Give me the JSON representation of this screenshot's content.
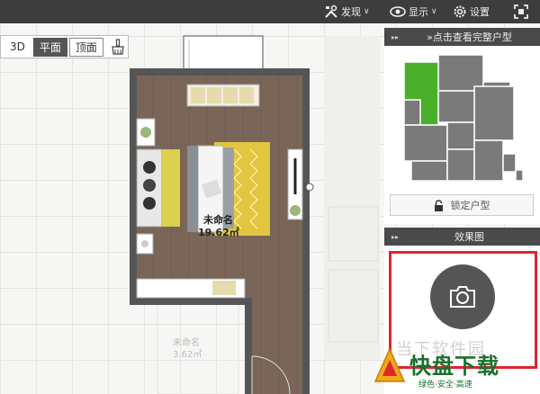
{
  "toolbar": {
    "discover_label": "发现",
    "display_label": "显示",
    "settings_label": "设置"
  },
  "view_toggle": {
    "mode_3d": "3D",
    "mode_plan": "平面",
    "mode_top": "顶面"
  },
  "floorplan": {
    "room_name": "未命名",
    "room_area": "19.62㎡",
    "ghost_room_name": "未命名",
    "ghost_room_area": "3.62㎡"
  },
  "panel_layout": {
    "header": "»点击查看完整户型",
    "lock_button": "锁定户型"
  },
  "panel_render": {
    "header": "效果图"
  },
  "watermark": {
    "faint_text": "当下软件园",
    "logo_text": "快盘下载",
    "slogan": "绿色·安全·高速"
  },
  "colors": {
    "toolbar_bg": "#3d3d3d",
    "floor": "#7a6658",
    "wall": "#555555",
    "highlight_room": "#4caf2a",
    "render_border": "#e0242e",
    "rug": "#e2c640"
  }
}
